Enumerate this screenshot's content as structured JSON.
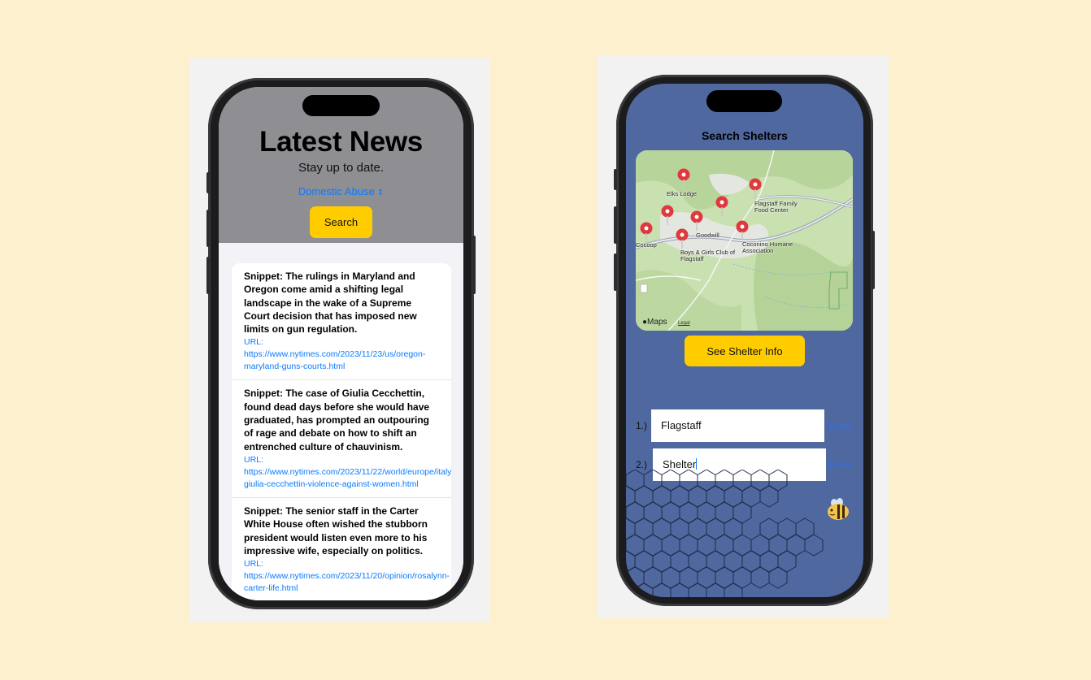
{
  "left_app": {
    "title": "Latest News",
    "subtitle": "Stay up to date.",
    "topic_picker": {
      "selected": "Domestic Abuse",
      "chevron": "⌃⌄"
    },
    "search_label": "Search",
    "articles": [
      {
        "snippet": "Snippet: The rulings in Maryland and Oregon come amid a shifting legal landscape in the wake of a Supreme Court decision that has imposed new limits on gun regulation.",
        "url": "URL: https://www.nytimes.com/2023/11/23/us/oregon-maryland-guns-courts.html"
      },
      {
        "snippet": "Snippet: The case of Giulia Cecchettin, found dead days before she would have graduated, has prompted an outpouring of rage and debate on how to shift an entrenched culture of chauvinism.",
        "url": "URL: https://www.nytimes.com/2023/11/22/world/europe/italy-giulia-cecchettin-violence-against-women.html"
      },
      {
        "snippet": "Snippet: The senior staff in the Carter White House often wished the stubborn president would listen even more to his impressive wife, especially on politics.",
        "url": "URL: https://www.nytimes.com/2023/11/20/opinion/rosalynn-carter-life.html"
      }
    ]
  },
  "right_app": {
    "title": "Search Shelters",
    "map": {
      "brand": "Maps",
      "legal": "Legal",
      "places": [
        {
          "label": "Elks Lodge"
        },
        {
          "label": "Flagstaff Family Food Center"
        },
        {
          "label": "Goodwill"
        },
        {
          "label": "Coconino Humane Association"
        },
        {
          "label": "Boys & Girls Club of Flagstaff"
        },
        {
          "label": "Cocoop"
        }
      ]
    },
    "info_button_label": "See Shelter Info",
    "fields": [
      {
        "number": "1.)",
        "value": "Flagstaff",
        "action": "Enter"
      },
      {
        "number": "2.)",
        "value": "Shelter",
        "action": "Enter"
      }
    ]
  },
  "colors": {
    "page_background": "#fdf0cf",
    "accent_yellow": "#ffcc00",
    "link_blue": "#0a7bff",
    "shelter_background": "#4f68a0",
    "news_header_gray": "#8e8e93"
  }
}
